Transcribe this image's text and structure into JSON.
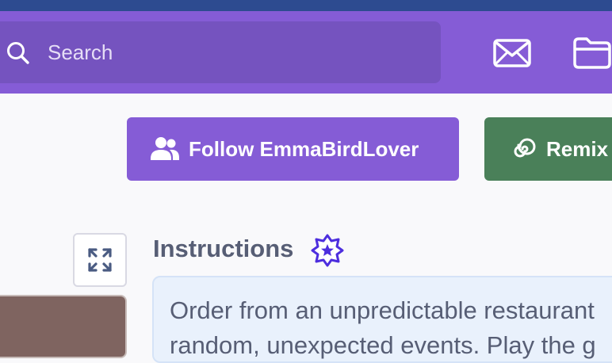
{
  "colors": {
    "top_strip": "#2d4b90",
    "navbar": "#855cd6",
    "search_bg": "#7553bf",
    "follow_button": "#855cd6",
    "remix_button": "#4a8059",
    "text": "#575e75",
    "instructions_bg": "#e9f1fc",
    "badge": "#4d2ede"
  },
  "navbar": {
    "search": {
      "placeholder": "Search",
      "value": "",
      "icon": "search-icon"
    },
    "icons": [
      "mail-icon",
      "folder-icon"
    ]
  },
  "actions": {
    "follow_label": "Follow EmmaBirdLover",
    "follow_icon": "user-group-icon",
    "remix_label": "Remix",
    "remix_icon": "spiral-icon"
  },
  "player": {
    "fullscreen_icon": "fullscreen-icon"
  },
  "instructions": {
    "title": "Instructions",
    "badge_icon": "star-badge-icon",
    "text_line1": "Order from an unpredictable restaurant",
    "text_line2": "random, unexpected events. Play the g"
  }
}
